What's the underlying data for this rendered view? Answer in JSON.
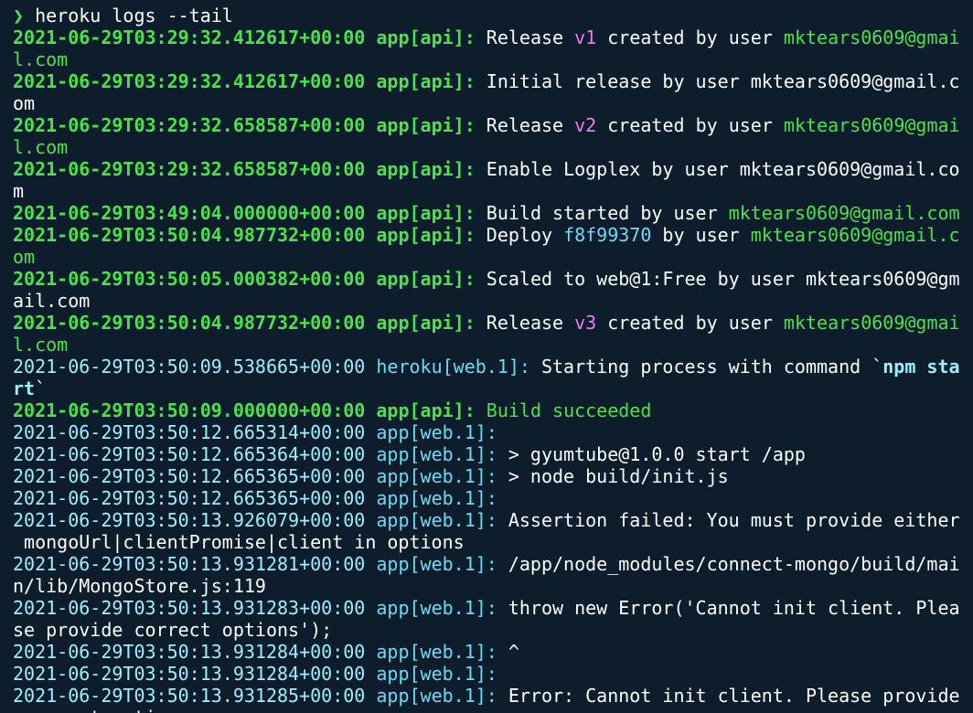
{
  "prompt": {
    "symbol": "❯",
    "command": "heroku logs --tail"
  },
  "colors": {
    "background": "#0d1d2c",
    "api_green": "#4be24b",
    "web_cyan": "#6bdcf6",
    "version_magenta": "#f276f6",
    "text_white": "#ffffff"
  },
  "lines": [
    {
      "kind": "seg",
      "segs": [
        {
          "t": "2021-06-29T03:29:32.412617+00:00",
          "c": "c-ts-g"
        },
        {
          "t": " ",
          "c": "c-white"
        },
        {
          "t": "app[api]:",
          "c": "c-src-g"
        },
        {
          "t": " Release ",
          "c": "c-white"
        },
        {
          "t": "v1",
          "c": "c-mag"
        },
        {
          "t": " created by user ",
          "c": "c-white"
        },
        {
          "t": "mktears0609@gmai",
          "c": "c-grn"
        }
      ]
    },
    {
      "kind": "seg",
      "segs": [
        {
          "t": "l.com",
          "c": "c-grn"
        }
      ]
    },
    {
      "kind": "seg",
      "segs": [
        {
          "t": "2021-06-29T03:29:32.412617+00:00",
          "c": "c-ts-g"
        },
        {
          "t": " ",
          "c": "c-white"
        },
        {
          "t": "app[api]:",
          "c": "c-src-g"
        },
        {
          "t": " Initial release by user mktears0609@gmail.c",
          "c": "c-white"
        }
      ]
    },
    {
      "kind": "seg",
      "segs": [
        {
          "t": "om",
          "c": "c-white"
        }
      ]
    },
    {
      "kind": "seg",
      "segs": [
        {
          "t": "2021-06-29T03:29:32.658587+00:00",
          "c": "c-ts-g"
        },
        {
          "t": " ",
          "c": "c-white"
        },
        {
          "t": "app[api]:",
          "c": "c-src-g"
        },
        {
          "t": " Release ",
          "c": "c-white"
        },
        {
          "t": "v2",
          "c": "c-mag"
        },
        {
          "t": " created by user ",
          "c": "c-white"
        },
        {
          "t": "mktears0609@gmai",
          "c": "c-grn"
        }
      ]
    },
    {
      "kind": "seg",
      "segs": [
        {
          "t": "l.com",
          "c": "c-grn"
        }
      ]
    },
    {
      "kind": "seg",
      "segs": [
        {
          "t": "2021-06-29T03:29:32.658587+00:00",
          "c": "c-ts-g"
        },
        {
          "t": " ",
          "c": "c-white"
        },
        {
          "t": "app[api]:",
          "c": "c-src-g"
        },
        {
          "t": " Enable Logplex by user mktears0609@gmail.co",
          "c": "c-white"
        }
      ]
    },
    {
      "kind": "seg",
      "segs": [
        {
          "t": "m",
          "c": "c-white"
        }
      ]
    },
    {
      "kind": "seg",
      "segs": [
        {
          "t": "2021-06-29T03:49:04.000000+00:00",
          "c": "c-ts-g"
        },
        {
          "t": " ",
          "c": "c-white"
        },
        {
          "t": "app[api]:",
          "c": "c-src-g"
        },
        {
          "t": " Build started by user ",
          "c": "c-white"
        },
        {
          "t": "mktears0609@gmail.com",
          "c": "c-grn"
        }
      ]
    },
    {
      "kind": "seg",
      "segs": [
        {
          "t": "2021-06-29T03:50:04.987732+00:00",
          "c": "c-ts-g"
        },
        {
          "t": " ",
          "c": "c-white"
        },
        {
          "t": "app[api]:",
          "c": "c-src-g"
        },
        {
          "t": " Deploy ",
          "c": "c-white"
        },
        {
          "t": "f8f99370",
          "c": "c-cyan"
        },
        {
          "t": " by user ",
          "c": "c-white"
        },
        {
          "t": "mktears0609@gmail.c",
          "c": "c-grn"
        }
      ]
    },
    {
      "kind": "seg",
      "segs": [
        {
          "t": "om",
          "c": "c-grn"
        }
      ]
    },
    {
      "kind": "seg",
      "segs": [
        {
          "t": "2021-06-29T03:50:05.000382+00:00",
          "c": "c-ts-g"
        },
        {
          "t": " ",
          "c": "c-white"
        },
        {
          "t": "app[api]:",
          "c": "c-src-g"
        },
        {
          "t": " Scaled to web@1:Free by user mktears0609@gm",
          "c": "c-white"
        }
      ]
    },
    {
      "kind": "seg",
      "segs": [
        {
          "t": "ail.com",
          "c": "c-white"
        }
      ]
    },
    {
      "kind": "seg",
      "segs": [
        {
          "t": "2021-06-29T03:50:04.987732+00:00",
          "c": "c-ts-g"
        },
        {
          "t": " ",
          "c": "c-white"
        },
        {
          "t": "app[api]:",
          "c": "c-src-g"
        },
        {
          "t": " Release ",
          "c": "c-white"
        },
        {
          "t": "v3",
          "c": "c-mag"
        },
        {
          "t": " created by user ",
          "c": "c-white"
        },
        {
          "t": "mktears0609@gmai",
          "c": "c-grn"
        }
      ]
    },
    {
      "kind": "seg",
      "segs": [
        {
          "t": "l.com",
          "c": "c-grn"
        }
      ]
    },
    {
      "kind": "seg",
      "segs": [
        {
          "t": "2021-06-29T03:50:09.538665+00:00",
          "c": "c-ts-c"
        },
        {
          "t": " ",
          "c": "c-white"
        },
        {
          "t": "heroku[web.1]:",
          "c": "c-src-c"
        },
        {
          "t": " Starting process with command `",
          "c": "c-white"
        },
        {
          "t": "npm sta",
          "c": "c-bold-cyan"
        }
      ]
    },
    {
      "kind": "seg",
      "segs": [
        {
          "t": "rt",
          "c": "c-bold-cyan"
        },
        {
          "t": "`",
          "c": "c-white"
        }
      ]
    },
    {
      "kind": "seg",
      "segs": [
        {
          "t": "2021-06-29T03:50:09.000000+00:00",
          "c": "c-ts-g"
        },
        {
          "t": " ",
          "c": "c-white"
        },
        {
          "t": "app[api]:",
          "c": "c-src-g"
        },
        {
          "t": " Build succeeded",
          "c": "c-grn"
        }
      ]
    },
    {
      "kind": "seg",
      "segs": [
        {
          "t": "2021-06-29T03:50:12.665314+00:00",
          "c": "c-ts-c"
        },
        {
          "t": " ",
          "c": "c-white"
        },
        {
          "t": "app[web.1]:",
          "c": "c-src-c"
        }
      ]
    },
    {
      "kind": "seg",
      "segs": [
        {
          "t": "2021-06-29T03:50:12.665364+00:00",
          "c": "c-ts-c"
        },
        {
          "t": " ",
          "c": "c-white"
        },
        {
          "t": "app[web.1]:",
          "c": "c-src-c"
        },
        {
          "t": " > gyumtube@1.0.0 start /app",
          "c": "c-white"
        }
      ]
    },
    {
      "kind": "seg",
      "segs": [
        {
          "t": "2021-06-29T03:50:12.665365+00:00",
          "c": "c-ts-c"
        },
        {
          "t": " ",
          "c": "c-white"
        },
        {
          "t": "app[web.1]:",
          "c": "c-src-c"
        },
        {
          "t": " > node build/init.js",
          "c": "c-white"
        }
      ]
    },
    {
      "kind": "seg",
      "segs": [
        {
          "t": "2021-06-29T03:50:12.665365+00:00",
          "c": "c-ts-c"
        },
        {
          "t": " ",
          "c": "c-white"
        },
        {
          "t": "app[web.1]:",
          "c": "c-src-c"
        }
      ]
    },
    {
      "kind": "seg",
      "segs": [
        {
          "t": "2021-06-29T03:50:13.926079+00:00",
          "c": "c-ts-c"
        },
        {
          "t": " ",
          "c": "c-white"
        },
        {
          "t": "app[web.1]:",
          "c": "c-src-c"
        },
        {
          "t": " Assertion failed: You must provide either",
          "c": "c-white"
        }
      ]
    },
    {
      "kind": "seg",
      "segs": [
        {
          "t": " mongoUrl|clientPromise|client in options",
          "c": "c-white"
        }
      ]
    },
    {
      "kind": "seg",
      "segs": [
        {
          "t": "2021-06-29T03:50:13.931281+00:00",
          "c": "c-ts-c"
        },
        {
          "t": " ",
          "c": "c-white"
        },
        {
          "t": "app[web.1]:",
          "c": "c-src-c"
        },
        {
          "t": " /app/node_modules/connect-mongo/build/mai",
          "c": "c-white"
        }
      ]
    },
    {
      "kind": "seg",
      "segs": [
        {
          "t": "n/lib/MongoStore.js:119",
          "c": "c-white"
        }
      ]
    },
    {
      "kind": "seg",
      "segs": [
        {
          "t": "2021-06-29T03:50:13.931283+00:00",
          "c": "c-ts-c"
        },
        {
          "t": " ",
          "c": "c-white"
        },
        {
          "t": "app[web.1]:",
          "c": "c-src-c"
        },
        {
          "t": " throw new Error('Cannot init client. Plea",
          "c": "c-white"
        }
      ]
    },
    {
      "kind": "seg",
      "segs": [
        {
          "t": "se provide correct options');",
          "c": "c-white"
        }
      ]
    },
    {
      "kind": "seg",
      "segs": [
        {
          "t": "2021-06-29T03:50:13.931284+00:00",
          "c": "c-ts-c"
        },
        {
          "t": " ",
          "c": "c-white"
        },
        {
          "t": "app[web.1]:",
          "c": "c-src-c"
        },
        {
          "t": " ^",
          "c": "c-white"
        }
      ]
    },
    {
      "kind": "seg",
      "segs": [
        {
          "t": "2021-06-29T03:50:13.931284+00:00",
          "c": "c-ts-c"
        },
        {
          "t": " ",
          "c": "c-white"
        },
        {
          "t": "app[web.1]:",
          "c": "c-src-c"
        }
      ]
    },
    {
      "kind": "seg",
      "segs": [
        {
          "t": "2021-06-29T03:50:13.931285+00:00",
          "c": "c-ts-c"
        },
        {
          "t": " ",
          "c": "c-white"
        },
        {
          "t": "app[web.1]:",
          "c": "c-src-c"
        },
        {
          "t": " Error: Cannot init client. Please provide",
          "c": "c-white"
        }
      ]
    },
    {
      "kind": "seg",
      "segs": [
        {
          "t": " correct options",
          "c": "c-white"
        }
      ]
    }
  ]
}
